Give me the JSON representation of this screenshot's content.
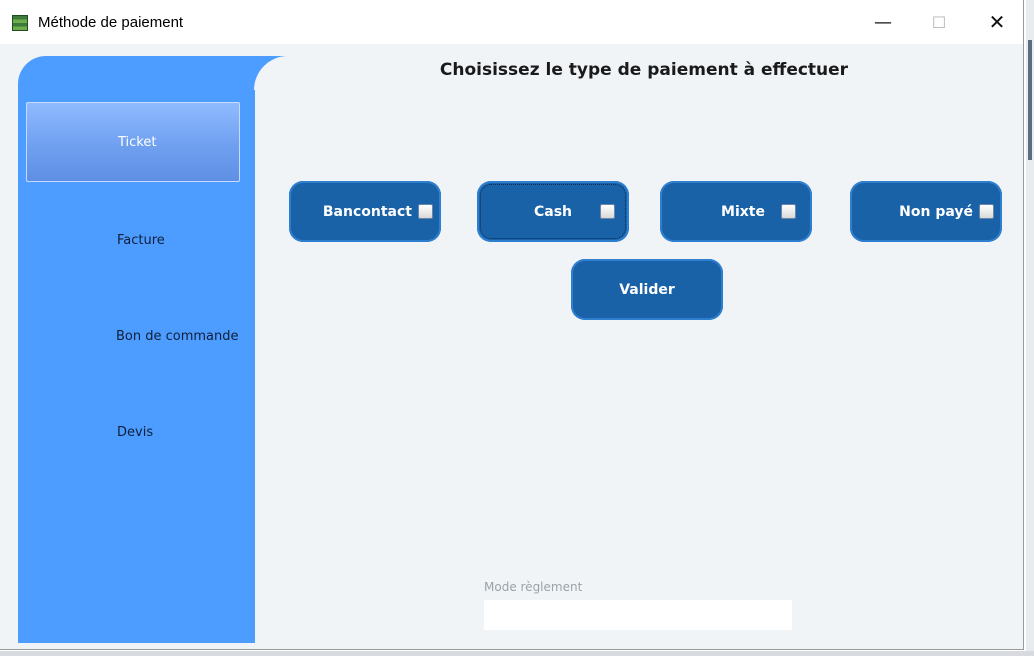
{
  "window": {
    "title": "Méthode de paiement",
    "controls": {
      "minimize": "—",
      "maximize": "☐",
      "close": "✕"
    }
  },
  "sidebar": {
    "items": [
      {
        "label": "Ticket",
        "active": true
      },
      {
        "label": "Facture",
        "active": false
      },
      {
        "label": "Bon de commande",
        "active": false
      },
      {
        "label": "Devis",
        "active": false
      }
    ]
  },
  "main": {
    "heading": "Choisissez le type de paiement à effectuer",
    "payment_options": [
      {
        "label": "Bancontact",
        "checked": false
      },
      {
        "label": "Cash",
        "checked": false,
        "focused": true
      },
      {
        "label": "Mixte",
        "checked": false
      },
      {
        "label": "Non payé",
        "checked": false
      }
    ],
    "validate_label": "Valider",
    "mode_reglement": {
      "label": "Mode règlement",
      "value": ""
    }
  },
  "colors": {
    "sidebar": "#4d9cff",
    "button": "#1a62a8",
    "content_bg": "#f0f4f7"
  }
}
